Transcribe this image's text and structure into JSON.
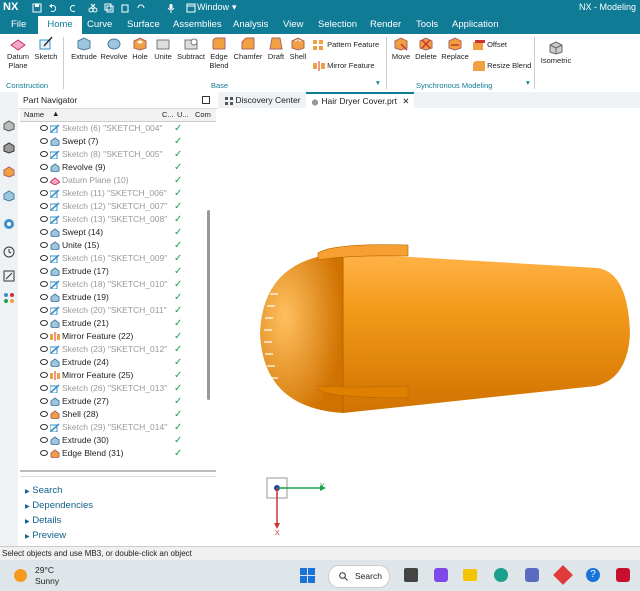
{
  "titlebar": {
    "logo": "NX",
    "window_menu": "Window",
    "app_title": "NX - Modeling"
  },
  "menubar": {
    "items": [
      "File",
      "Home",
      "Curve",
      "Surface",
      "Assemblies",
      "Analysis",
      "View",
      "Selection",
      "Render",
      "Tools",
      "Application"
    ]
  },
  "ribbon": {
    "construction": {
      "datum_plane": "Datum Plane",
      "sketch": "Sketch",
      "group": "Construction"
    },
    "base": {
      "extrude": "Extrude",
      "revolve": "Revolve",
      "hole": "Hole",
      "unite": "Unite",
      "subtract": "Subtract",
      "edge_blend": "Edge Blend",
      "chamfer": "Chamfer",
      "draft": "Draft",
      "shell": "Shell",
      "pattern_feature": "Pattern Feature",
      "mirror_feature": "Mirror Feature",
      "group": "Base"
    },
    "synchronous": {
      "move": "Move",
      "delete": "Delete",
      "replace": "Replace",
      "offset": "Offset",
      "resize_blend": "Resize Blend",
      "group": "Synchronous Modeling"
    },
    "view": {
      "isometric": "Isometric"
    }
  },
  "navigator": {
    "title": "Part Navigator",
    "columns": [
      "Name",
      "C...",
      "U...",
      "Com"
    ],
    "rows": [
      {
        "label": "Sketch (6) \"SKETCH_004\"",
        "dim": true
      },
      {
        "label": "Swept (7)",
        "dim": false
      },
      {
        "label": "Sketch (8) \"SKETCH_005\"",
        "dim": true
      },
      {
        "label": "Revolve (9)",
        "dim": false
      },
      {
        "label": "Datum Plane (10)",
        "dim": true
      },
      {
        "label": "Sketch (11) \"SKETCH_006\"",
        "dim": true
      },
      {
        "label": "Sketch (12) \"SKETCH_007\"",
        "dim": true
      },
      {
        "label": "Sketch (13) \"SKETCH_008\"",
        "dim": true
      },
      {
        "label": "Swept (14)",
        "dim": false
      },
      {
        "label": "Unite (15)",
        "dim": false
      },
      {
        "label": "Sketch (16) \"SKETCH_009\"",
        "dim": true
      },
      {
        "label": "Extrude (17)",
        "dim": false
      },
      {
        "label": "Sketch (18) \"SKETCH_010\"",
        "dim": true
      },
      {
        "label": "Extrude (19)",
        "dim": false
      },
      {
        "label": "Sketch (20) \"SKETCH_011\"",
        "dim": true
      },
      {
        "label": "Extrude (21)",
        "dim": false
      },
      {
        "label": "Mirror Feature (22)",
        "dim": false
      },
      {
        "label": "Sketch (23) \"SKETCH_012\"",
        "dim": true
      },
      {
        "label": "Extrude (24)",
        "dim": false
      },
      {
        "label": "Mirror Feature (25)",
        "dim": false
      },
      {
        "label": "Sketch (26) \"SKETCH_013\"",
        "dim": true
      },
      {
        "label": "Extrude (27)",
        "dim": false
      },
      {
        "label": "Shell (28)",
        "dim": false
      },
      {
        "label": "Sketch (29) \"SKETCH_014\"",
        "dim": true
      },
      {
        "label": "Extrude (30)",
        "dim": false
      },
      {
        "label": "Edge Blend (31)",
        "dim": false
      }
    ],
    "sections": [
      "Search",
      "Dependencies",
      "Details",
      "Preview"
    ]
  },
  "tabs": {
    "discovery": "Discovery Center",
    "part": "Hair Dryer Cover.prt"
  },
  "triad": {
    "y": "Y",
    "x": "X"
  },
  "status": "Select objects and use MB3, or double-click an object",
  "taskbar": {
    "temp": "29°C",
    "weather": "Sunny",
    "search": "Search"
  },
  "colors": {
    "accent": "#0f7b95",
    "model": "#f08a00",
    "check": "#1aa34a"
  }
}
